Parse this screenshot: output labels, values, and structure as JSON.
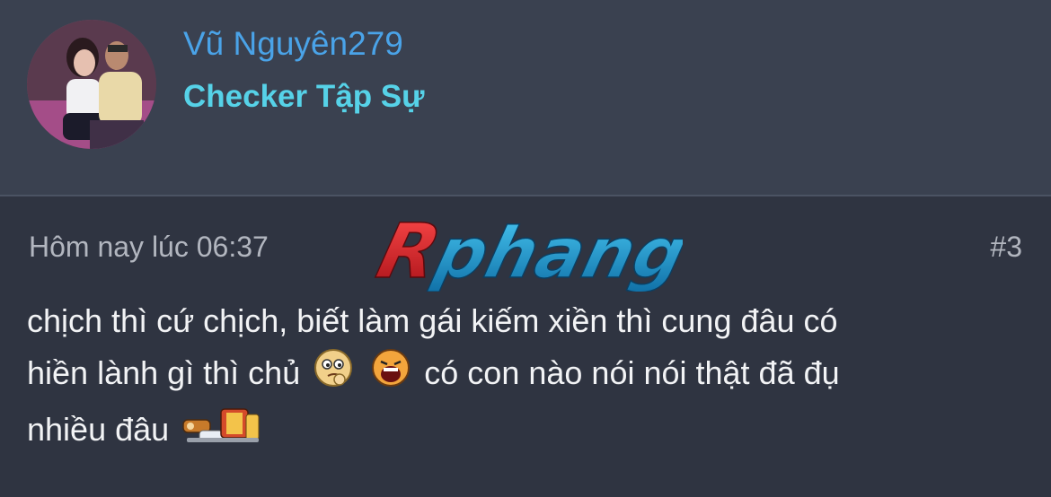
{
  "user": {
    "username": "Vũ Nguyên279",
    "title": "Checker Tập Sự"
  },
  "post": {
    "timestamp": "Hôm nay lúc 06:37",
    "number": "#3",
    "text_line1": "chịch thì cứ chịch, biết làm gái kiếm xiền thì cung đâu có",
    "text_line2_start": "hiền lành gì thì chủ",
    "text_line2_end": "có con nào nói nói thật đã đụ",
    "text_line3": "nhiều đâu"
  },
  "watermark": {
    "text": "Rphang"
  },
  "colors": {
    "username": "#4aa3e8",
    "user_title": "#56d2e8",
    "header_bg": "#3a4150",
    "body_bg": "#2f3441"
  },
  "icons": [
    "avatar-photo",
    "thinking-emoji",
    "laughing-emoji",
    "dancing-emoji"
  ]
}
